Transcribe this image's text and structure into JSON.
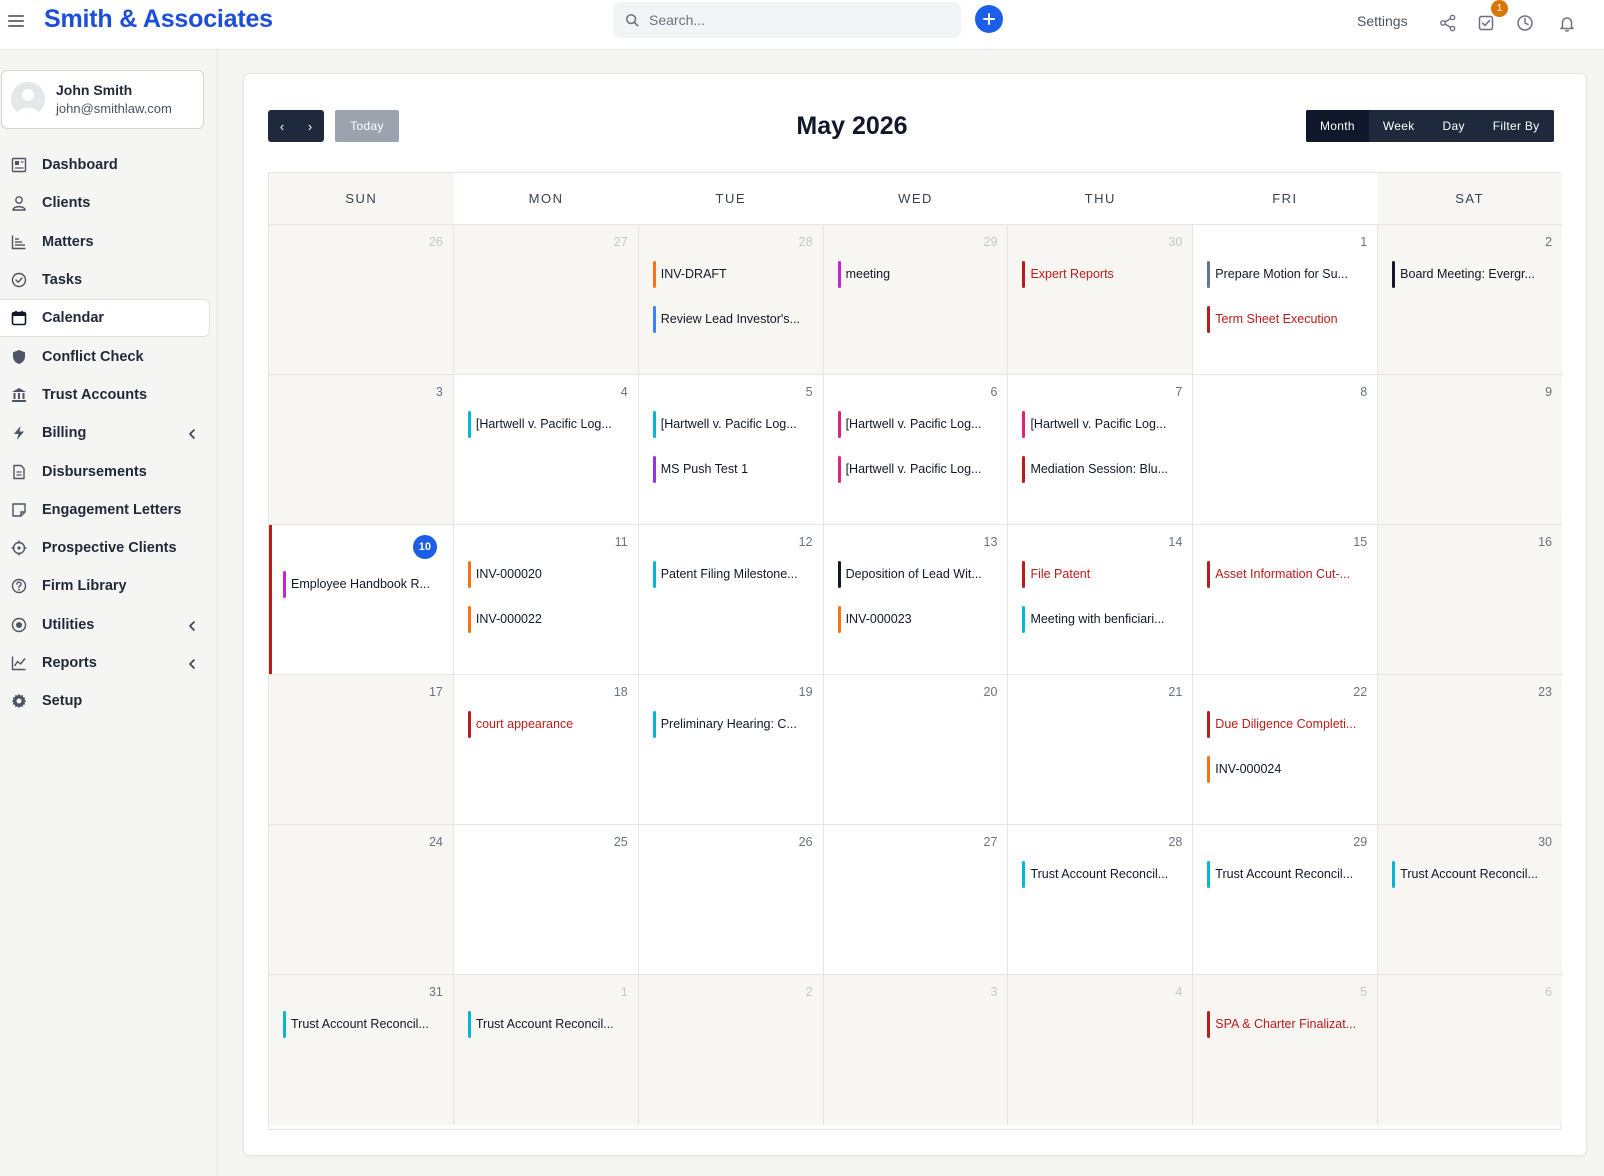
{
  "app": {
    "brand": "Smith & Associates"
  },
  "search": {
    "placeholder": "Search..."
  },
  "topbar": {
    "settings_label": "Settings",
    "notification_count": "1"
  },
  "user": {
    "name": "John Smith",
    "email": "john@smithlaw.com"
  },
  "sidebar": {
    "items": [
      {
        "label": "Dashboard",
        "icon": "dashboard-icon"
      },
      {
        "label": "Clients",
        "icon": "user-icon"
      },
      {
        "label": "Matters",
        "icon": "matters-chart-icon"
      },
      {
        "label": "Tasks",
        "icon": "check-circle-icon"
      },
      {
        "label": "Calendar",
        "icon": "calendar-icon",
        "active": true
      },
      {
        "label": "Conflict Check",
        "icon": "shield-icon"
      },
      {
        "label": "Trust Accounts",
        "icon": "bank-icon"
      },
      {
        "label": "Billing",
        "icon": "bolt-icon",
        "has_chevron": true
      },
      {
        "label": "Disbursements",
        "icon": "document-icon"
      },
      {
        "label": "Engagement Letters",
        "icon": "note-icon"
      },
      {
        "label": "Prospective Clients",
        "icon": "crosshair-icon"
      },
      {
        "label": "Firm Library",
        "icon": "help-circle-icon"
      },
      {
        "label": "Utilities",
        "icon": "radio-icon",
        "has_chevron": true
      },
      {
        "label": "Reports",
        "icon": "line-chart-icon",
        "has_chevron": true
      },
      {
        "label": "Setup",
        "icon": "gear-icon"
      }
    ]
  },
  "calendar": {
    "title": "May 2026",
    "today_label": "Today",
    "prev_label": "‹",
    "next_label": "›",
    "views": [
      "Month",
      "Week",
      "Day",
      "Filter By"
    ],
    "active_view": "Month",
    "weekdays": [
      "SUN",
      "MON",
      "TUE",
      "WED",
      "THU",
      "FRI",
      "SAT"
    ],
    "colors": {
      "orange": "#f97316",
      "blue": "#3b82f6",
      "pink": "#db2777",
      "magenta": "#c026d3",
      "red": "#b91c1c",
      "slate": "#64748b",
      "black": "#111827",
      "cyan": "#06b6d4",
      "purple": "#9333ea",
      "today": "#1d5ee8"
    },
    "weeks": [
      [
        {
          "day": "26",
          "other": true,
          "events": []
        },
        {
          "day": "27",
          "other": true,
          "events": []
        },
        {
          "day": "28",
          "other": true,
          "events": [
            {
              "title": "INV-DRAFT",
              "color": "#f97316"
            },
            {
              "title": "Review Lead Investor's...",
              "color": "#3b82f6"
            }
          ]
        },
        {
          "day": "29",
          "other": true,
          "events": [
            {
              "title": "meeting",
              "color": "#c026d3"
            }
          ]
        },
        {
          "day": "30",
          "other": true,
          "events": [
            {
              "title": "Expert Reports",
              "color": "#b91c1c",
              "red": true
            }
          ]
        },
        {
          "day": "1",
          "events": [
            {
              "title": "Prepare Motion for Su...",
              "color": "#64748b"
            },
            {
              "title": "Term Sheet Execution",
              "color": "#b91c1c",
              "red": true
            }
          ]
        },
        {
          "day": "2",
          "events": [
            {
              "title": "Board Meeting: Evergr...",
              "color": "#111827"
            }
          ]
        }
      ],
      [
        {
          "day": "3",
          "events": []
        },
        {
          "day": "4",
          "events": [
            {
              "title": "[Hartwell v. Pacific Log...",
              "color": "#06b6d4"
            }
          ]
        },
        {
          "day": "5",
          "events": [
            {
              "title": "[Hartwell v. Pacific Log...",
              "color": "#06b6d4"
            },
            {
              "title": "MS Push Test 1",
              "color": "#9333ea"
            }
          ]
        },
        {
          "day": "6",
          "events": [
            {
              "title": "[Hartwell v. Pacific Log...",
              "color": "#db2777"
            },
            {
              "title": "[Hartwell v. Pacific Log...",
              "color": "#db2777"
            }
          ]
        },
        {
          "day": "7",
          "events": [
            {
              "title": "[Hartwell v. Pacific Log...",
              "color": "#db2777"
            },
            {
              "title": "Mediation Session: Blu...",
              "color": "#b91c1c"
            }
          ]
        },
        {
          "day": "8",
          "events": []
        },
        {
          "day": "9",
          "events": []
        }
      ],
      [
        {
          "day": "10",
          "today": true,
          "events": [
            {
              "title": "Employee Handbook R...",
              "color": "#c026d3"
            }
          ]
        },
        {
          "day": "11",
          "events": [
            {
              "title": "INV-000020",
              "color": "#f97316"
            },
            {
              "title": "INV-000022",
              "color": "#f97316"
            }
          ]
        },
        {
          "day": "12",
          "events": [
            {
              "title": "Patent Filing Milestone...",
              "color": "#06b6d4"
            }
          ]
        },
        {
          "day": "13",
          "events": [
            {
              "title": "Deposition of Lead Wit...",
              "color": "#111827"
            },
            {
              "title": "INV-000023",
              "color": "#f97316"
            }
          ]
        },
        {
          "day": "14",
          "events": [
            {
              "title": "File Patent",
              "color": "#b91c1c",
              "red": true
            },
            {
              "title": "Meeting with benficiari...",
              "color": "#06b6d4"
            }
          ]
        },
        {
          "day": "15",
          "events": [
            {
              "title": "Asset Information Cut-...",
              "color": "#b91c1c",
              "red": true
            }
          ]
        },
        {
          "day": "16",
          "events": []
        }
      ],
      [
        {
          "day": "17",
          "events": []
        },
        {
          "day": "18",
          "events": [
            {
              "title": "court appearance",
              "color": "#b91c1c",
              "red": true
            }
          ]
        },
        {
          "day": "19",
          "events": [
            {
              "title": "Preliminary Hearing: C...",
              "color": "#06b6d4"
            }
          ]
        },
        {
          "day": "20",
          "events": []
        },
        {
          "day": "21",
          "events": []
        },
        {
          "day": "22",
          "events": [
            {
              "title": "Due Diligence Completi...",
              "color": "#b91c1c",
              "red": true
            },
            {
              "title": "INV-000024",
              "color": "#f97316"
            }
          ]
        },
        {
          "day": "23",
          "events": []
        }
      ],
      [
        {
          "day": "24",
          "events": []
        },
        {
          "day": "25",
          "events": []
        },
        {
          "day": "26",
          "events": []
        },
        {
          "day": "27",
          "events": []
        },
        {
          "day": "28",
          "events": [
            {
              "title": "Trust Account Reconcil...",
              "color": "#06b6d4"
            }
          ]
        },
        {
          "day": "29",
          "events": [
            {
              "title": "Trust Account Reconcil...",
              "color": "#06b6d4"
            }
          ]
        },
        {
          "day": "30",
          "events": [
            {
              "title": "Trust Account Reconcil...",
              "color": "#06b6d4"
            }
          ]
        }
      ],
      [
        {
          "day": "31",
          "events": [
            {
              "title": "Trust Account Reconcil...",
              "color": "#06b6d4"
            }
          ]
        },
        {
          "day": "1",
          "other": true,
          "events": [
            {
              "title": "Trust Account Reconcil...",
              "color": "#06b6d4"
            }
          ]
        },
        {
          "day": "2",
          "other": true,
          "events": []
        },
        {
          "day": "3",
          "other": true,
          "events": []
        },
        {
          "day": "4",
          "other": true,
          "events": []
        },
        {
          "day": "5",
          "other": true,
          "events": [
            {
              "title": "SPA & Charter Finalizat...",
              "color": "#b91c1c",
              "red": true
            }
          ]
        },
        {
          "day": "6",
          "other": true,
          "events": []
        }
      ]
    ]
  }
}
